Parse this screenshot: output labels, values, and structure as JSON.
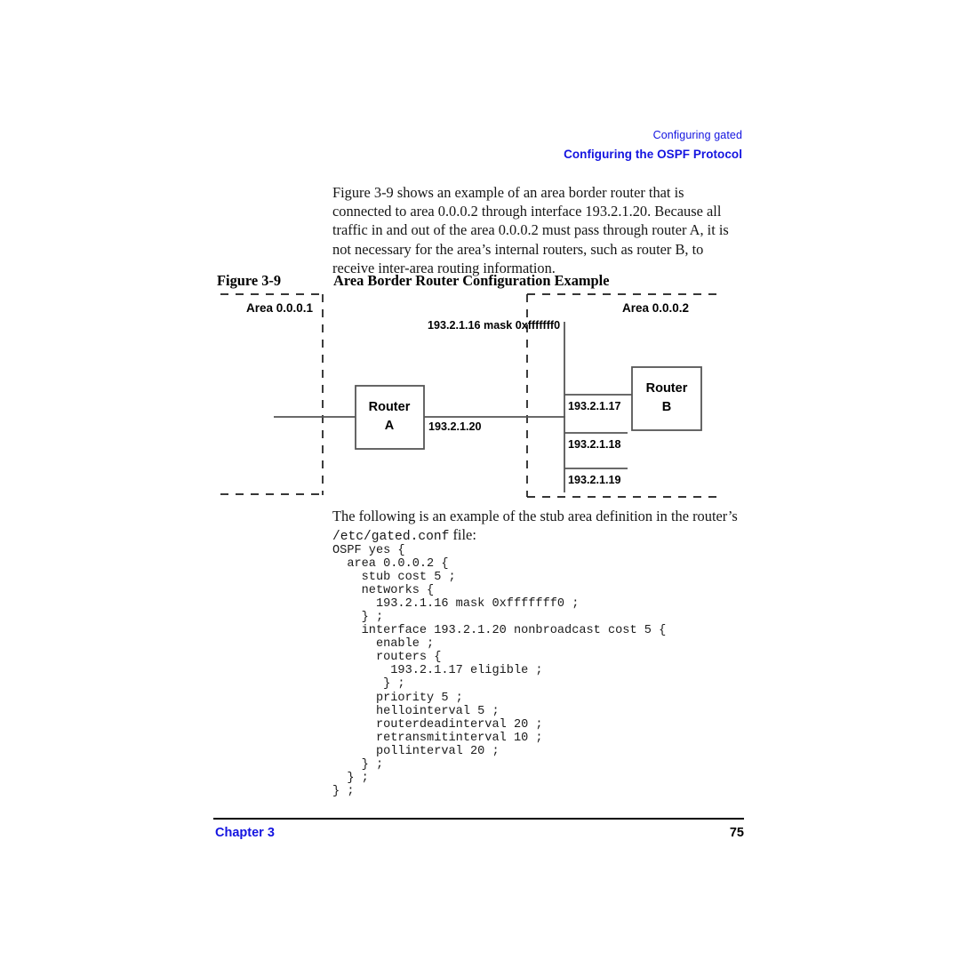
{
  "running_head": {
    "book_title": "Configuring gated",
    "section_title": "Configuring the OSPF Protocol",
    "color": "#1414e0"
  },
  "intro_paragraph": "Figure 3-9 shows an example of an area border router that is connected to area 0.0.0.2 through interface 193.2.1.20. Because all traffic in and out of the area 0.0.0.2 must pass through router A, it is not necessary for the area’s internal routers, such as router B, to receive inter-area routing information.",
  "figure": {
    "number_label": "Figure 3-9",
    "title": "Area Border Router Configuration Example",
    "area_left_label": "Area 0.0.0.1",
    "area_right_label": "Area 0.0.0.2",
    "network_label": "193.2.1.16 mask 0xfffffff0",
    "router_a_name": "Router",
    "router_a_id": "A",
    "router_b_name": "Router",
    "router_b_id": "B",
    "interface_a_label": "193.2.1.20",
    "interface_17_label": "193.2.1.17",
    "interface_18_label": "193.2.1.18",
    "interface_19_label": "193.2.1.19",
    "line_color": "#555555",
    "dash_color": "#1a1a1a"
  },
  "stub_paragraph": {
    "text_before": "The following is an example of the stub area definition in the router’s ",
    "filename": "/etc/gated.conf",
    "text_after": " file:"
  },
  "code_listing": "OSPF yes {\n  area 0.0.0.2 {\n    stub cost 5 ;\n    networks {\n      193.2.1.16 mask 0xfffffff0 ;\n    } ;\n    interface 193.2.1.20 nonbroadcast cost 5 {\n      enable ;\n      routers {\n        193.2.1.17 eligible ;\n       } ;\n      priority 5 ;\n      hellointerval 5 ;\n      routerdeadinterval 20 ;\n      retransmitinterval 10 ;\n      pollinterval 20 ;\n    } ;\n  } ;\n} ;",
  "footer": {
    "chapter_label": "Chapter 3",
    "page_number": "75",
    "chapter_color": "#1414e0"
  }
}
